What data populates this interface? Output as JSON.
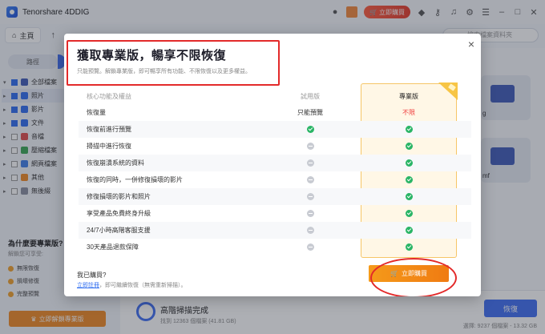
{
  "app": {
    "title": "Tenorshare 4DDIG",
    "buy_now": "立即購買"
  },
  "nav": {
    "home": "主頁",
    "search_placeholder": "搜索檔案資料夾"
  },
  "sidebar": {
    "tab_label": "路徑",
    "tree": [
      {
        "label": "全部檔案",
        "checked": true,
        "color": "#3f5bb8"
      },
      {
        "label": "照片",
        "checked": true,
        "color": "#2f6df0"
      },
      {
        "label": "影片",
        "checked": true,
        "color": "#2f6df0"
      },
      {
        "label": "文件",
        "checked": true,
        "color": "#2f6df0"
      },
      {
        "label": "音檔",
        "checked": false,
        "color": "#e04c4c"
      },
      {
        "label": "壓縮檔案",
        "checked": false,
        "color": "#3aa655"
      },
      {
        "label": "網頁檔案",
        "checked": false,
        "color": "#3f7ee8"
      },
      {
        "label": "其他",
        "checked": false,
        "color": "#f08a24"
      },
      {
        "label": "無後綴",
        "checked": false,
        "color": "#8a8fa0"
      }
    ],
    "why_pro": "為什麼要專業版?",
    "why_sub": "解鎖您可享受:",
    "perks": [
      "無限恢復",
      "損壞修復",
      "完整預覽"
    ],
    "unlock_button": "立即解鎖專業版"
  },
  "background": {
    "folder_labels": [
      "g",
      "mf"
    ],
    "scan_title": "高階掃描完成",
    "scan_sub": "找到 12363 個檔案 (41.81 GB)",
    "recover_button": "恢復",
    "stats": "選擇: 9237 個檔案 - 13.32 GB"
  },
  "modal": {
    "title": "獲取專業版，暢享不限恢復",
    "subtitle": "只能預覽。解鎖專業版，即可暢享所有功能、不限恢復以及更多權益。",
    "header": {
      "feature": "核心功能及權益",
      "trial": "試用版",
      "pro": "專業版"
    },
    "rows": [
      {
        "feature": "恢復量",
        "trial": "只能預覽",
        "pro": "不限",
        "trial_kind": "text",
        "pro_kind": "text"
      },
      {
        "feature": "恢復前進行預覽",
        "trial_kind": "check",
        "pro_kind": "check"
      },
      {
        "feature": "掃描中進行恢復",
        "trial_kind": "no",
        "pro_kind": "check"
      },
      {
        "feature": "恢復崩潰系統的資料",
        "trial_kind": "no",
        "pro_kind": "check"
      },
      {
        "feature": "恢復的同時，一併修復損壞的影片",
        "trial_kind": "no",
        "pro_kind": "check"
      },
      {
        "feature": "修復損壞的影片和照片",
        "trial_kind": "no",
        "pro_kind": "check"
      },
      {
        "feature": "享受產品免費終身升級",
        "trial_kind": "no",
        "pro_kind": "check"
      },
      {
        "feature": "24/7小時高階客服支援",
        "trial_kind": "no",
        "pro_kind": "check"
      },
      {
        "feature": "30天產品退款保障",
        "trial_kind": "no",
        "pro_kind": "check"
      }
    ],
    "purchased_q": "我已購買?",
    "register_link": "立即註冊",
    "register_rest": "，即可繼續恢復（無需重新掃描）。",
    "buy_button": "立即購買"
  },
  "colors": {
    "accent": "#3f6ff3",
    "buy_orange": "#f08a24",
    "annotation_red": "#e32a2a",
    "check_green": "#2ab566"
  }
}
